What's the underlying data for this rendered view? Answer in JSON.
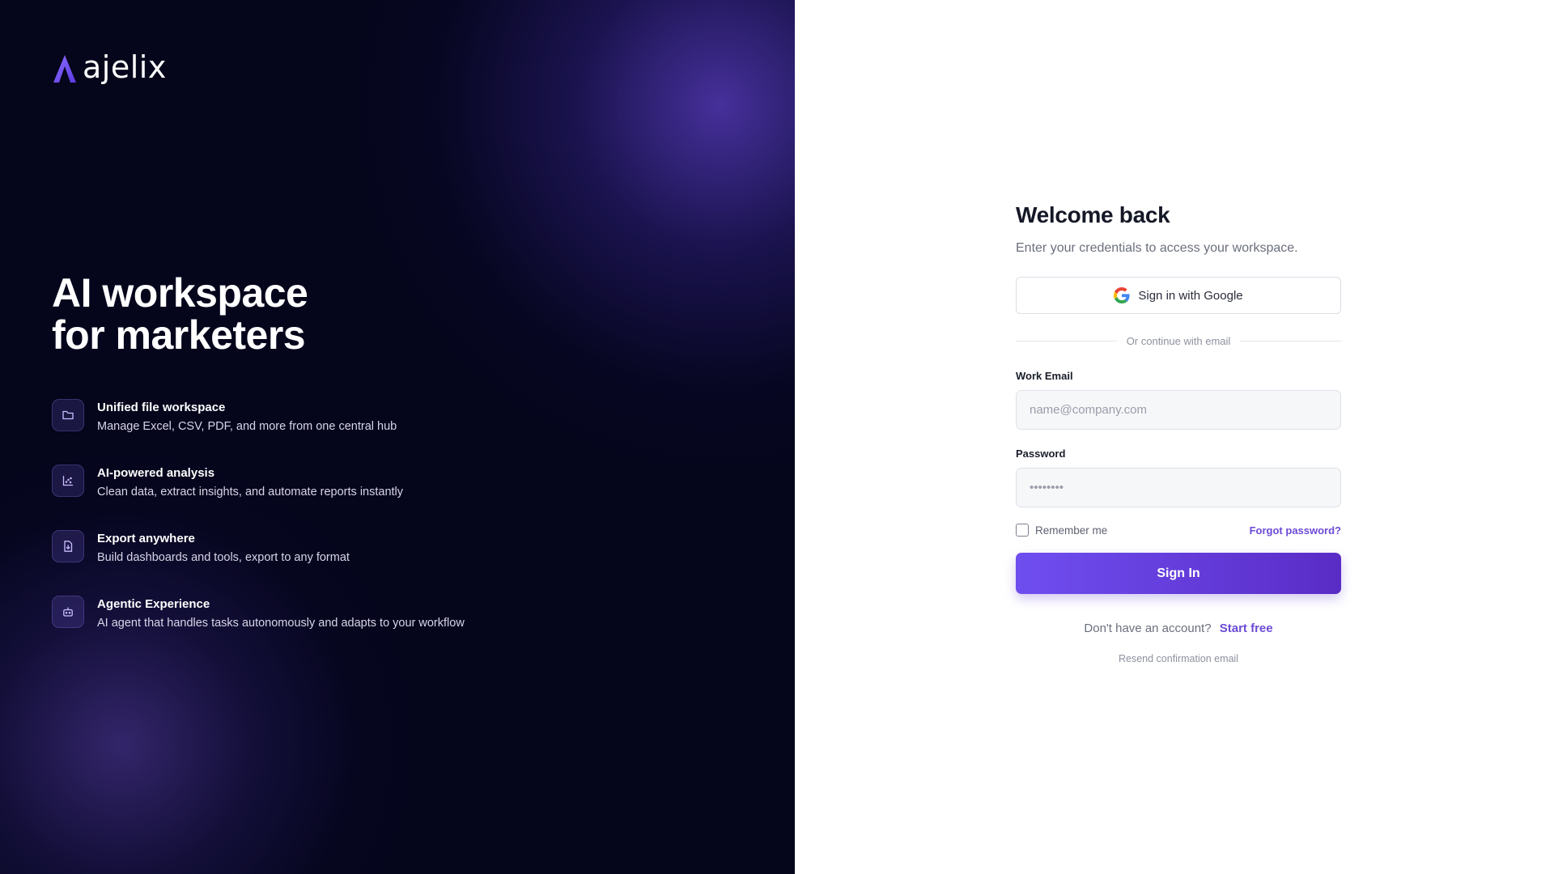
{
  "brand": {
    "name": "ajelix",
    "accent": "#6f4ef0"
  },
  "hero": {
    "line1": "AI workspace",
    "line2": "for marketers"
  },
  "features": [
    {
      "icon": "folder-icon",
      "title": "Unified file workspace",
      "desc": "Manage Excel, CSV, PDF, and more from one central hub"
    },
    {
      "icon": "chart-icon",
      "title": "AI-powered analysis",
      "desc": "Clean data, extract insights, and automate reports instantly"
    },
    {
      "icon": "file-export-icon",
      "title": "Export anywhere",
      "desc": "Build dashboards and tools, export to any format"
    },
    {
      "icon": "bot-icon",
      "title": "Agentic Experience",
      "desc": "AI agent that handles tasks autonomously and adapts to your workflow"
    }
  ],
  "form": {
    "title": "Welcome back",
    "subtitle": "Enter your credentials to access your workspace.",
    "google_label": "Sign in with Google",
    "divider": "Or continue with email",
    "email_label": "Work Email",
    "email_placeholder": "name@company.com",
    "password_label": "Password",
    "password_placeholder": "••••••••",
    "remember_label": "Remember me",
    "forgot_label": "Forgot password?",
    "signin_label": "Sign In",
    "no_account": "Don't have an account?",
    "start_free": "Start free",
    "resend": "Resend confirmation email"
  }
}
